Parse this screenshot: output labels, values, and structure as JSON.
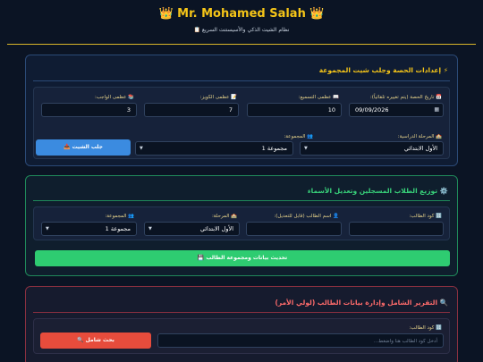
{
  "header": {
    "title": "👑 Mr. Mohamed Salah 👑",
    "subtitle": "📋 نظام الشيت الذكي والأسيستنت السريع"
  },
  "session": {
    "title": "⚡ إعدادات الحصة وجلب شيت المجموعة",
    "date_label": "📅 تاريخ الحصة (يتم تغييره تلقائياً):",
    "date_value": "09/09/2026",
    "recite_label": "📖 عظمى التسميع:",
    "recite_value": "10",
    "quiz_label": "📝 عظمى الكويز:",
    "quiz_value": "7",
    "homework_label": "📚 عظمى الواجب:",
    "homework_value": "3",
    "stage_label": "🏫 المرحلة الدراسية:",
    "stage_value": "الأول الابتدائي",
    "group_label": "👥 المجموعة:",
    "group_value": "مجموعة 1",
    "fetch_button": "📥 جلب الشيت"
  },
  "distribute": {
    "title": "⚙️ توزيع الطلاب المسجلين وتعديل الأسماء",
    "code_label": "🔢 كود الطالب:",
    "code_value": "",
    "name_label": "👤 اسم الطالب (قابل للتعديل):",
    "name_value": "",
    "stage_label": "🏫 المرحلة:",
    "stage_value": "الأول الابتدائي",
    "group_label": "👥 المجموعة:",
    "group_value": "مجموعة 1",
    "update_button": "💾 تحديث بيانات ومجموعة الطالب"
  },
  "report": {
    "title": "🔍 التقرير الشامل وإدارة بيانات الطالب (لولي الأمر)",
    "code_label": "🔢 كود الطالب:",
    "search_placeholder": "أدخل كود الطالب هنا واضغط...",
    "search_button": "🔍 بحث شامل"
  }
}
